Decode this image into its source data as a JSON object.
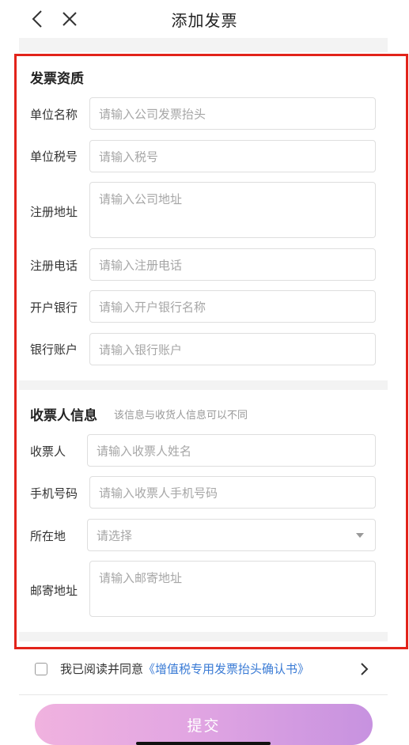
{
  "header": {
    "title": "添加发票"
  },
  "invoice_section": {
    "title": "发票资质",
    "fields": [
      {
        "label": "单位名称",
        "placeholder": "请输入公司发票抬头"
      },
      {
        "label": "单位税号",
        "placeholder": "请输入税号"
      },
      {
        "label": "注册地址",
        "placeholder": "请输入公司地址"
      },
      {
        "label": "注册电话",
        "placeholder": "请输入注册电话"
      },
      {
        "label": "开户银行",
        "placeholder": "请输入开户银行名称"
      },
      {
        "label": "银行账户",
        "placeholder": "请输入银行账户"
      }
    ]
  },
  "recipient_section": {
    "title": "收票人信息",
    "subtitle": "该信息与收货人信息可以不同",
    "fields": [
      {
        "label": "收票人",
        "placeholder": "请输入收票人姓名"
      },
      {
        "label": "手机号码",
        "placeholder": "请输入收票人手机号码"
      },
      {
        "label": "所在地",
        "placeholder": "请选择"
      },
      {
        "label": "邮寄地址",
        "placeholder": "请输入邮寄地址"
      }
    ]
  },
  "agreement": {
    "prefix": "我已阅读并同意",
    "link": "《增值税专用发票抬头确认书》",
    "checked": false
  },
  "submit": {
    "label": "提交"
  },
  "colors": {
    "highlight": "#e2231a",
    "link": "#3a7bd5",
    "submit_start": "#f0b2df",
    "submit_end": "#c792e0"
  }
}
